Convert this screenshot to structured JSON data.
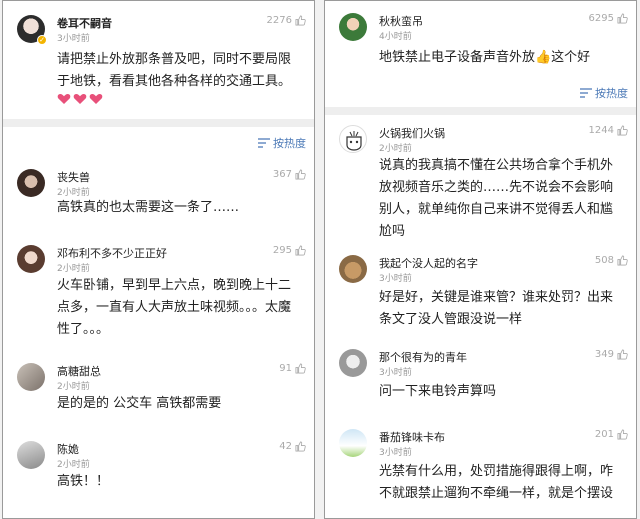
{
  "left": {
    "top_comment": {
      "username": "卷耳不嗣音",
      "time": "3小时前",
      "likes": "2276",
      "text": "请把禁止外放那条普及吧，同时不要局限于地铁，看看其他各种各样的交通工具。"
    },
    "sort_label": "按热度",
    "comments": [
      {
        "username": "丧失兽",
        "time": "2小时前",
        "likes": "367",
        "text": "高铁真的也太需要这一条了……"
      },
      {
        "username": "邓布利不多不少正正好",
        "time": "2小时前",
        "likes": "295",
        "text": "火车卧铺，早到早上六点，晚到晚上十二点多，一直有人大声放土味视频。。。太魔性了。。。"
      },
      {
        "username": "高糖甜总",
        "time": "2小时前",
        "likes": "91",
        "text": "是的是的 公交车 高铁都需要"
      },
      {
        "username": "陈姽",
        "time": "2小时前",
        "likes": "42",
        "text": "高铁！！"
      }
    ]
  },
  "right": {
    "top_comment": {
      "username": "秋秋蛮吊",
      "time": "4小时前",
      "likes": "6295",
      "text": "地铁禁止电子设备声音外放👍这个好"
    },
    "sort_label": "按热度",
    "comments": [
      {
        "username": "火锅我们火锅",
        "time": "2小时前",
        "likes": "1244",
        "text": "说真的我真搞不懂在公共场合拿个手机外放视频音乐之类的……先不说会不会影响别人，就单纯你自己来讲不觉得丢人和尴尬吗"
      },
      {
        "username": "我起个没人起的名字",
        "time": "3小时前",
        "likes": "508",
        "text": "好是好，关键是谁来管？谁来处罚？出来条文了没人管跟没说一样"
      },
      {
        "username": "那个很有为的青年",
        "time": "3小时前",
        "likes": "349",
        "text": "问一下来电铃声算吗"
      },
      {
        "username": "番茄锋味卡布",
        "time": "3小时前",
        "likes": "201",
        "text": "光禁有什么用，处罚措施得跟得上啊，咋不就跟禁止遛狗不牵绳一样，就是个摆设"
      }
    ]
  },
  "colors": {
    "accent": "#4a78b6",
    "heart": "#e8507a",
    "badge": "#f3b400"
  }
}
